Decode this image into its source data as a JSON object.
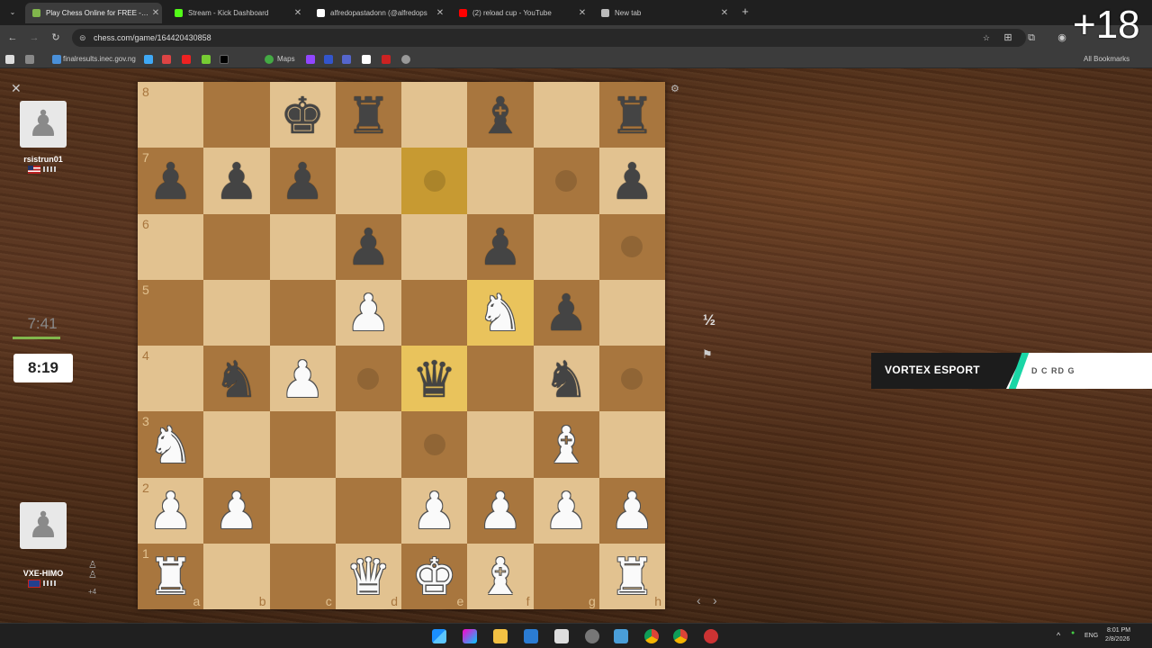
{
  "tabs": [
    {
      "title": "Play Chess Online for FREE - 2 P",
      "active": true,
      "icon": "chess-pawn-icon",
      "color": "#81b64c"
    },
    {
      "title": "Stream - Kick Dashboard",
      "active": false,
      "icon": "kick-icon",
      "color": "#53fc18"
    },
    {
      "title": "alfredopastadonn (@alfredops",
      "active": false,
      "icon": "tiktok-icon",
      "color": "#ffffff"
    },
    {
      "title": "(2) reload cup - YouTube",
      "active": false,
      "icon": "youtube-icon",
      "color": "#ff0000"
    },
    {
      "title": "New tab",
      "active": false,
      "icon": "globe-icon",
      "color": "#bbbbbb"
    }
  ],
  "address": {
    "url": "chess.com/game/164420430858"
  },
  "bookmarks": {
    "items": [
      "finalresults.inec.gov.ng",
      "Maps"
    ],
    "all_label": "All Bookmarks"
  },
  "stream_overlay": {
    "counter": "+18",
    "banner": "VORTEX ESPORT",
    "banner_sub": "D C RD  G"
  },
  "board": {
    "rows": [
      [
        "",
        "",
        "bk",
        "br",
        "",
        "bb",
        "",
        "br"
      ],
      [
        "bp",
        "bp",
        "bp",
        "",
        "",
        "",
        "",
        "bp"
      ],
      [
        "",
        "",
        "",
        "bp",
        "",
        "bp",
        "",
        ""
      ],
      [
        "",
        "",
        "",
        "wp",
        "",
        "wn",
        "bp",
        ""
      ],
      [
        "",
        "bn",
        "wp",
        "",
        "bq",
        "",
        "bn",
        ""
      ],
      [
        "wn",
        "",
        "",
        "",
        "",
        "",
        "wb",
        ""
      ],
      [
        "wp",
        "wp",
        "",
        "",
        "wp",
        "wp",
        "wp",
        "wp"
      ],
      [
        "wr",
        "",
        "",
        "wq",
        "wk",
        "wb",
        "",
        "wr"
      ]
    ],
    "highlights": [
      "e7",
      "f5",
      "e4"
    ],
    "dots": [
      "e7",
      "g7",
      "h6",
      "d4",
      "h4",
      "e3"
    ],
    "rank_labels": [
      "8",
      "7",
      "6",
      "5",
      "4",
      "3",
      "2",
      "1"
    ],
    "file_labels": [
      "a",
      "b",
      "c",
      "d",
      "e",
      "f",
      "g",
      "h"
    ],
    "colors": {
      "light": "#e2c290",
      "dark": "#a8763e",
      "highlight": "#e9c35c"
    }
  },
  "top_player": {
    "name": "rsistrun01",
    "clock": "7:41",
    "flag": "US"
  },
  "bottom_player": {
    "name": "VXE-HIMO",
    "clock": "8:19",
    "flag": "GB",
    "material_diff": "+4"
  },
  "board_controls": {
    "draw_label": "½",
    "resign_icon": "flag-icon",
    "settings_icon": "gear-icon"
  },
  "tray": {
    "language": "ENG",
    "time": "8:01 PM",
    "date": "2/8/2026"
  }
}
